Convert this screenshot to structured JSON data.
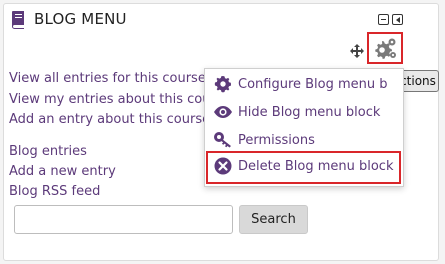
{
  "block": {
    "title": "BLOG MENU",
    "icon": "book-icon"
  },
  "header_controls": {
    "move_icon": "move-icon",
    "actions_icon": "gear-icon",
    "dock_buttons": [
      "minimize-icon",
      "dock-icon"
    ],
    "tooltip": "Actions"
  },
  "links": {
    "view_all": "View all entries for this course",
    "view_mine": "View my entries about this cou",
    "add_entry_course": "Add an entry about this course",
    "blog_entries": "Blog entries",
    "add_new_entry": "Add a new entry",
    "rss_feed": "Blog RSS feed"
  },
  "actions_menu": {
    "items": [
      {
        "label": "Configure Blog menu b",
        "icon": "gear-icon"
      },
      {
        "label": "Hide Blog menu block",
        "icon": "eye-icon"
      },
      {
        "label": "Permissions",
        "icon": "key-icon"
      },
      {
        "label": "Delete Blog menu block",
        "icon": "delete-icon"
      }
    ]
  },
  "search": {
    "value": "",
    "button_label": "Search"
  },
  "colors": {
    "link": "#5c3a7a",
    "highlight": "#d9262a",
    "icon": "#5c3a7a"
  }
}
